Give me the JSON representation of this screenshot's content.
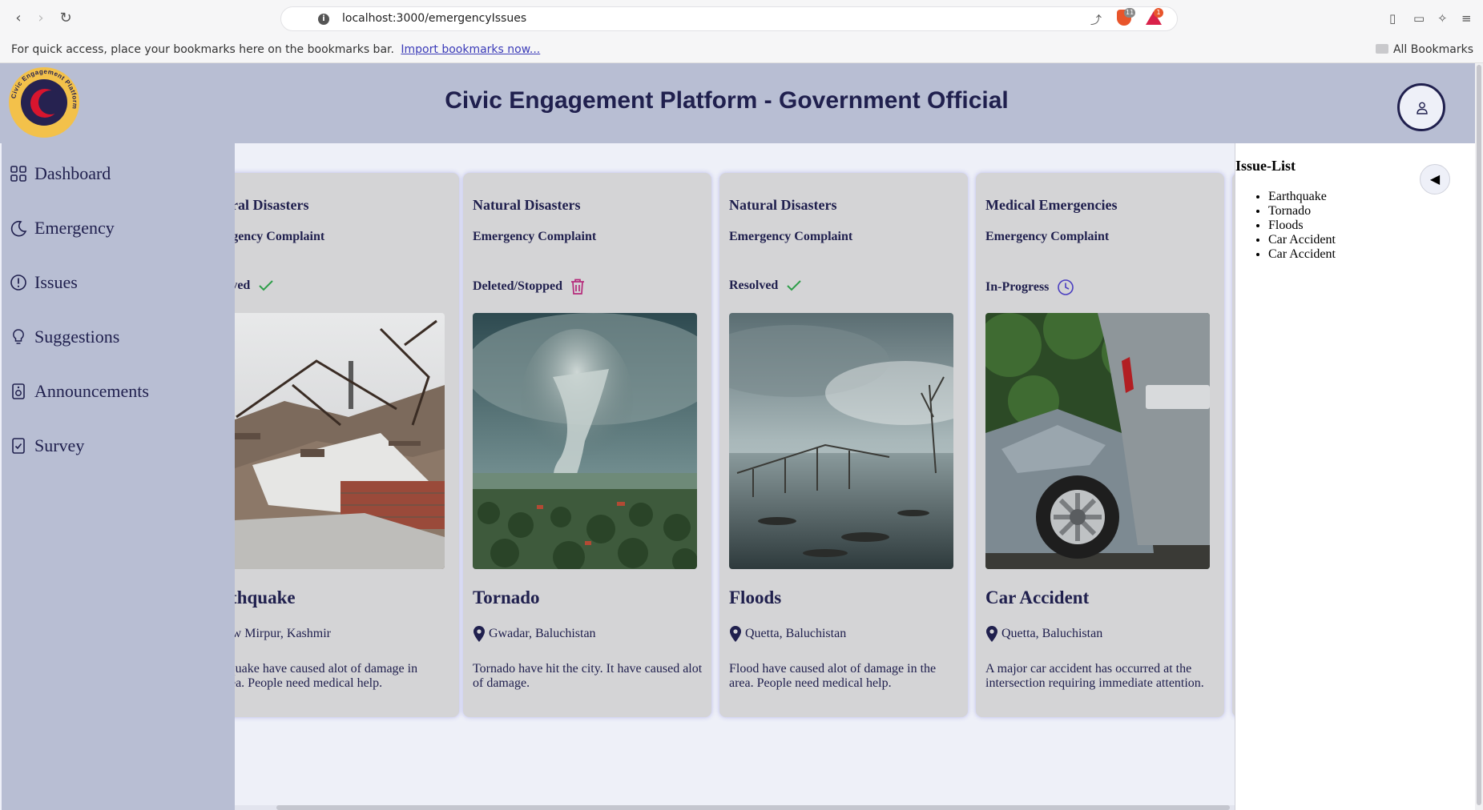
{
  "browser": {
    "url": "localhost:3000/emergencyIssues",
    "bookmarks_prompt": "For quick access, place your bookmarks here on the bookmarks bar.",
    "import_link": "Import bookmarks now...",
    "all_bookmarks": "All Bookmarks",
    "brave_badge": "11",
    "rewards_badge": "1"
  },
  "header": {
    "title": "Civic Engagement Platform - Government Official",
    "logo_text": "Civic Engagement Platform"
  },
  "sidebar": {
    "items": [
      {
        "label": "Dashboard",
        "icon": "grid-icon"
      },
      {
        "label": "Emergency",
        "icon": "moon-icon"
      },
      {
        "label": "Issues",
        "icon": "exclamation-circle-icon"
      },
      {
        "label": "Suggestions",
        "icon": "lightbulb-icon"
      },
      {
        "label": "Announcements",
        "icon": "speaker-icon"
      },
      {
        "label": "Survey",
        "icon": "clipboard-check-icon"
      }
    ]
  },
  "cards": [
    {
      "category": "Natural Disasters",
      "type": "Emergency Complaint",
      "status": "Resolved",
      "status_icon": "check-icon",
      "title": "Earthquake",
      "location": "New Mirpur, Kashmir",
      "description": "Earthquake have caused alot of damage in the area. People need medical help."
    },
    {
      "category": "Natural Disasters",
      "type": "Emergency Complaint",
      "status": "Deleted/Stopped",
      "status_icon": "trash-icon",
      "title": "Tornado",
      "location": "Gwadar, Baluchistan",
      "description": "Tornado have hit the city. It have caused alot of damage."
    },
    {
      "category": "Natural Disasters",
      "type": "Emergency Complaint",
      "status": "Resolved",
      "status_icon": "check-icon",
      "title": "Floods",
      "location": "Quetta, Baluchistan",
      "description": "Flood have caused alot of damage in the area. People need medical help."
    },
    {
      "category": "Medical Emergencies",
      "type": "Emergency Complaint",
      "status": "In-Progress",
      "status_icon": "clock-icon",
      "title": "Car Accident",
      "location": "Quetta, Baluchistan",
      "description": "A major car accident has occurred at the intersection requiring immediate attention."
    }
  ],
  "issue_list": {
    "heading": "Issue-List",
    "items": [
      "Earthquake",
      "Tornado",
      "Floods",
      "Car Accident",
      "Car Accident"
    ],
    "collapse_glyph": "◀"
  },
  "colors": {
    "navy": "#20204e",
    "header_bg": "#b8bed3",
    "card_bg": "#d4d4d6",
    "resolved": "#2e9e4a",
    "deleted": "#b5297a",
    "in_progress": "#4a3ec0"
  }
}
